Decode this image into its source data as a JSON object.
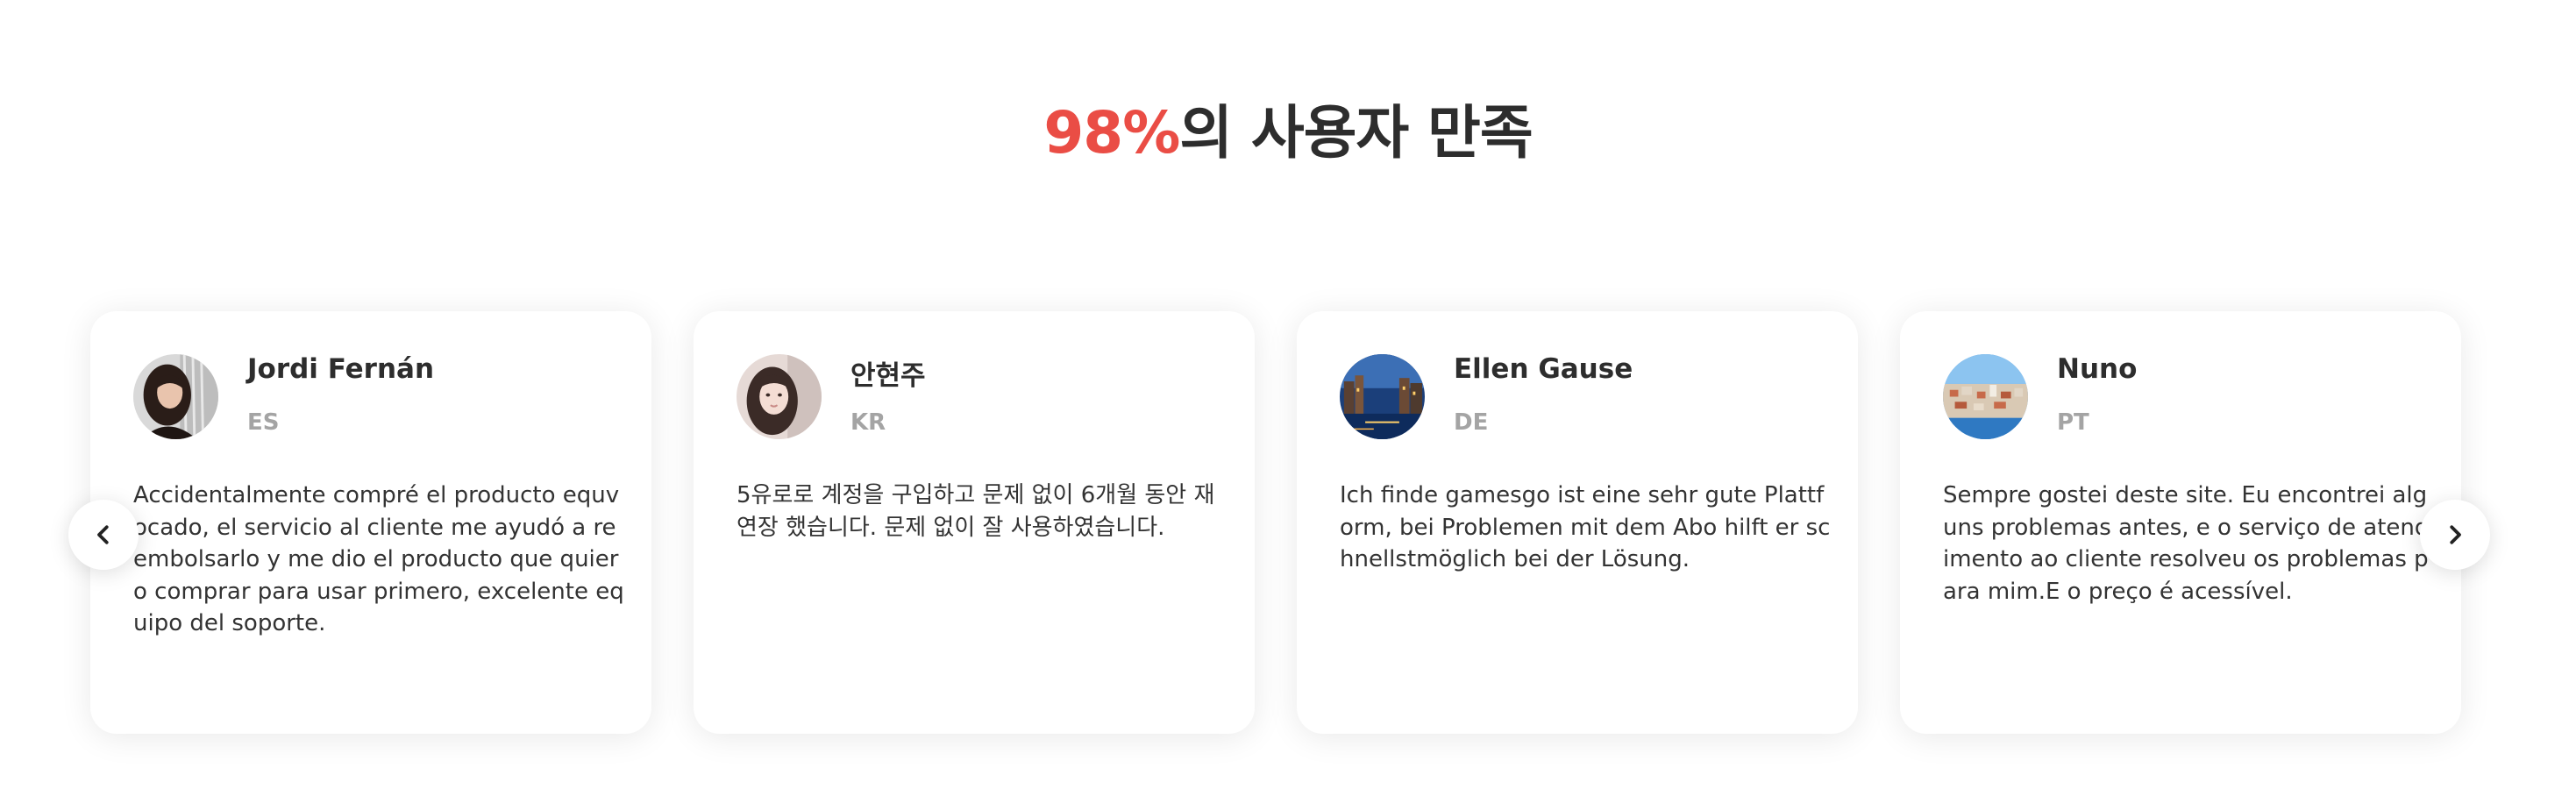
{
  "heading": {
    "highlight": "98%",
    "rest": "의 사용자 만족",
    "highlight_color": "#ea4d45"
  },
  "carousel": {
    "prev_icon": "chevron-left-icon",
    "next_icon": "chevron-right-icon"
  },
  "reviews": [
    {
      "name": "Jordi Fernán",
      "country": "ES",
      "avatar": "woman-portrait-avatar",
      "text": "Accidentalmente compré el producto equvocado, el servicio al cliente me ayudó a reembolsarlo y me dio el producto que quiero comprar para usar primero, excelente equipo del soporte."
    },
    {
      "name": "안현주",
      "country": "KR",
      "avatar": "girl-portrait-avatar",
      "text": "5유로로 계정을 구입하고 문제 없이 6개월 동안 재 연장 했습니다. 문제 없이 잘 사용하였습니다."
    },
    {
      "name": "Ellen Gause",
      "country": "DE",
      "avatar": "night-city-canal-avatar",
      "text": "Ich finde gamesgo ist eine sehr gute Plattform, bei Problemen mit dem Abo hilft er schnellstmöglich bei der Lösung."
    },
    {
      "name": "Nuno",
      "country": "PT",
      "avatar": "coastal-city-avatar",
      "text": "Sempre gostei deste site. Eu encontrei alguns problemas antes, e o serviço de atendimento ao cliente resolveu os problemas para mim.E o preço é acessível."
    }
  ]
}
